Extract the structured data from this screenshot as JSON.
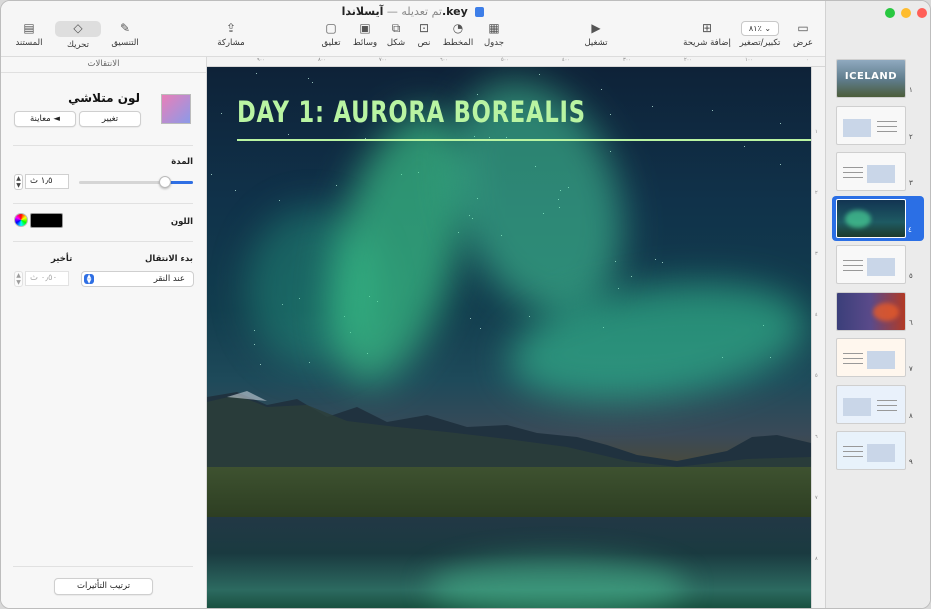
{
  "window": {
    "title": "آيسلاندا.key",
    "edited": "تم تعديله",
    "separator": "—"
  },
  "toolbar": {
    "view": "عرض",
    "zoom_value": "٨١٪",
    "zoom_label": "تكبير/تصغير",
    "add_slide": "إضافة شريحة",
    "play": "تشغيل",
    "table": "جدول",
    "chart": "المخطط",
    "text": "نص",
    "shape": "شكل",
    "media": "وسائط",
    "comment": "تعليق",
    "share": "مشاركة",
    "format": "التنسيق",
    "animate": "تحريك",
    "document": "المستند"
  },
  "inspector": {
    "header": "الانتقالات",
    "transition_name": "لون متلاشي",
    "change_button": "تغيير",
    "preview_button": "معاينة ◄",
    "duration_label": "المدة",
    "duration_value": "١٫٥ ث",
    "color_label": "اللون",
    "start_transition_label": "بدء الانتقال",
    "start_transition_value": "عند النقر",
    "delay_label": "تأخير",
    "delay_value": "٠٫٥٠ ث",
    "build_order_button": "ترتيب التأثيرات"
  },
  "ruler": {
    "top": [
      "٩٠٠",
      "٨٠٠",
      "٧٠٠",
      "٦٠٠",
      "٥٠٠",
      "٤٠٠",
      "٣٠٠",
      "٢٠٠",
      "١٠٠",
      "٠"
    ],
    "right": [
      "١",
      "٢",
      "٣",
      "٤",
      "٥",
      "٦",
      "٧",
      "٨"
    ]
  },
  "slide": {
    "title": "DAY 1: AURORA BOREALIS"
  },
  "navigator": {
    "slides": [
      {
        "num": "١",
        "caption": "ICELAND"
      },
      {
        "num": "٢"
      },
      {
        "num": "٣"
      },
      {
        "num": "٤",
        "selected": true
      },
      {
        "num": "٥"
      },
      {
        "num": "٦"
      },
      {
        "num": "٧"
      },
      {
        "num": "٨"
      },
      {
        "num": "٩"
      }
    ]
  },
  "colors": {
    "accent": "#2b6fe5",
    "slide_title": "#b9f4a2",
    "close": "#ff5f57",
    "minimize": "#febc2e",
    "zoom": "#28c840"
  }
}
